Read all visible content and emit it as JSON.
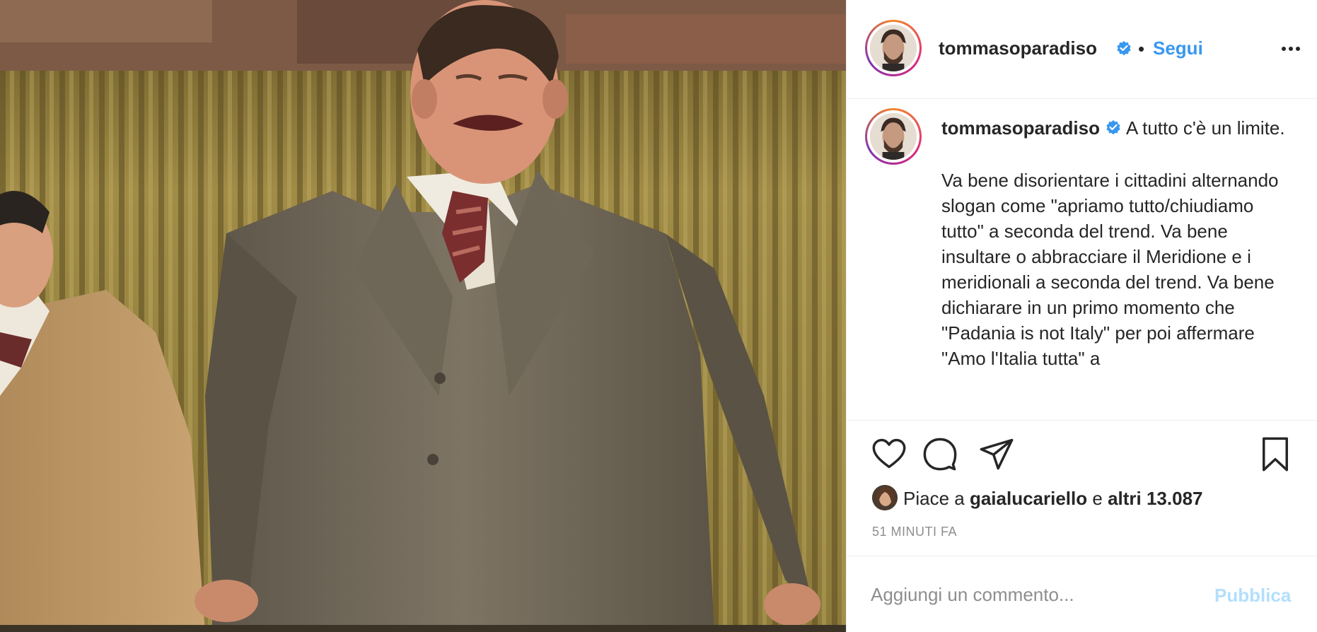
{
  "post": {
    "author": {
      "username": "tommasoparadiso",
      "verified": true
    },
    "follow_label": "Segui",
    "dot_separator": "•",
    "caption": {
      "username": "tommasoparadiso",
      "first_line": " A tutto c'è un limite.",
      "body": "Va bene disorientare i cittadini alternando slogan come \"apriamo tutto/chiudiamo tutto\" a seconda del trend. Va bene insultare o abbracciare il Meridione e i meridionali a seconda del trend. Va bene dichiarare in un primo momento che \"Padania is not Italy\" per poi affermare \"Amo l'Italia tutta\" a"
    },
    "likes": {
      "prefix": "Piace a ",
      "liker": "gaialucariello",
      "conjunction": " e ",
      "others": "altri 13.087"
    },
    "timestamp": "51 MINUTI FA",
    "comment": {
      "placeholder": "Aggiungi un commento...",
      "publish_label": "Pubblica"
    },
    "icons": {
      "verified": "verified-badge-icon",
      "more": "more-options-icon",
      "like": "heart-icon",
      "comment": "comment-bubble-icon",
      "share": "paper-plane-icon",
      "save": "bookmark-icon"
    },
    "colors": {
      "link_blue": "#3897f0",
      "publish_disabled": "#b2dffc",
      "muted_text": "#8e8e8e",
      "text": "#262626"
    }
  }
}
